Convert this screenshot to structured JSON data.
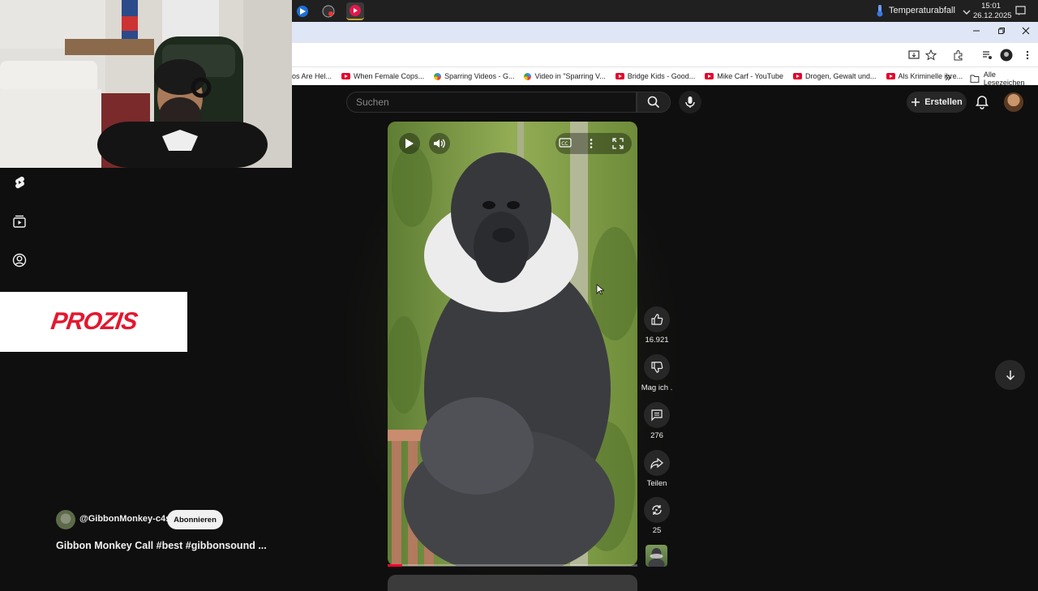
{
  "taskbar": {
    "weather_text": "Temperaturabfall",
    "time": "15:01",
    "date": "26.12.2025"
  },
  "bookmarks": [
    {
      "label": "os Are Hel...",
      "icon": "none"
    },
    {
      "label": "When Female Cops...",
      "icon": "youtube-icon"
    },
    {
      "label": "Sparring Videos - G...",
      "icon": "gemini-icon"
    },
    {
      "label": "Video in \"Sparring V...",
      "icon": "gemini-icon"
    },
    {
      "label": "Bridge Kids - Good...",
      "icon": "youtube-icon"
    },
    {
      "label": "Mike Carf - YouTube",
      "icon": "youtube-icon"
    },
    {
      "label": "Drogen, Gewalt und...",
      "icon": "youtube-icon"
    },
    {
      "label": "Als Kriminelle ihre...",
      "icon": "youtube-icon"
    }
  ],
  "bookmarks_all": "Alle Lesezeichen",
  "ad": {
    "logo_text": "PROZIS"
  },
  "header": {
    "search_placeholder": "Suchen",
    "create_label": "Erstellen"
  },
  "video": {
    "progress": 0.06
  },
  "actions": {
    "like_count": "16.921",
    "dislike_label": "Mag ich .",
    "comments_count": "276",
    "share_label": "Teilen",
    "remix_count": "25"
  },
  "channel": {
    "handle": "@GibbonMonkey-c4s",
    "subscribe_label": "Abonnieren"
  },
  "video_title": "Gibbon Monkey Call #best #gibbonsound ...",
  "colors": {
    "background": "#0f0f0f",
    "accent_red": "#ff0033",
    "ad_red": "#e4172f"
  }
}
